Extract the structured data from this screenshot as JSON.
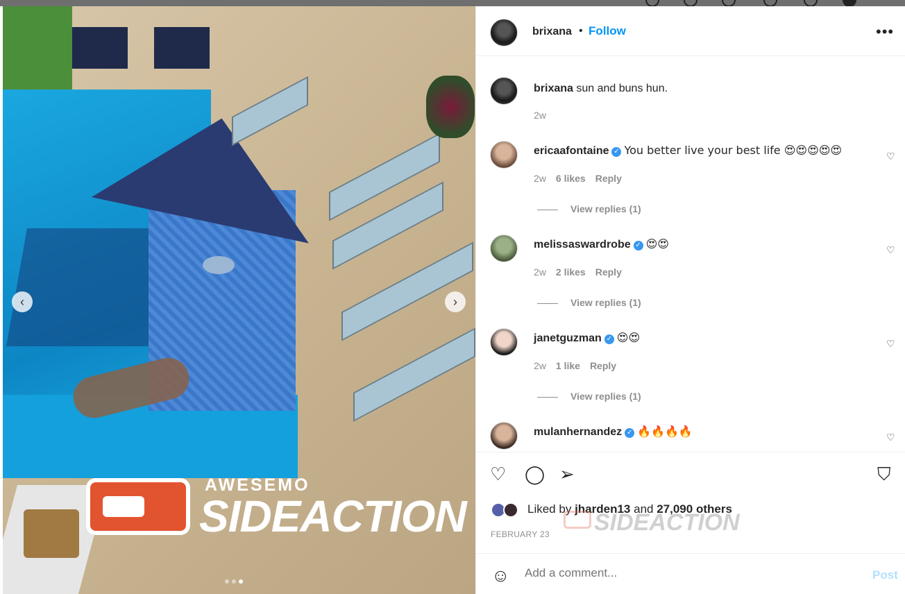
{
  "post": {
    "username": "brixana",
    "follow_label": "Follow",
    "separator": "•",
    "more_icon": "more-horizontal-icon"
  },
  "caption": {
    "username": "brixana",
    "text": "sun and buns hun.",
    "time": "2w"
  },
  "comments": [
    {
      "username": "ericaafontaine",
      "verified": true,
      "text": "You better live your best life 😍😍😍😍😍",
      "time": "2w",
      "likes": "6 likes",
      "reply_label": "Reply",
      "view_replies": "View replies (1)"
    },
    {
      "username": "melissaswardrobe",
      "verified": true,
      "text": "😍😍",
      "time": "2w",
      "likes": "2 likes",
      "reply_label": "Reply",
      "view_replies": "View replies (1)"
    },
    {
      "username": "janetguzman",
      "verified": true,
      "text": "😍😍",
      "time": "2w",
      "likes": "1 like",
      "reply_label": "Reply",
      "view_replies": "View replies (1)"
    },
    {
      "username": "mulanhernandez",
      "verified": true,
      "text": "🔥🔥🔥🔥"
    }
  ],
  "actions": {
    "liked_prefix": "Liked by",
    "liked_user": "jharden13",
    "liked_and": "and",
    "liked_others": "27,090 others",
    "date": "FEBRUARY 23"
  },
  "add_comment": {
    "placeholder": "Add a comment...",
    "post_label": "Post"
  },
  "watermark": {
    "small": "AWESEMO",
    "big": "SIDEACTION",
    "ghost": "SIDEACTION"
  },
  "colors": {
    "follow": "#0095f6",
    "verified": "#3897f0",
    "post_disabled": "#b2dffc",
    "meta": "#8e8e8e"
  }
}
